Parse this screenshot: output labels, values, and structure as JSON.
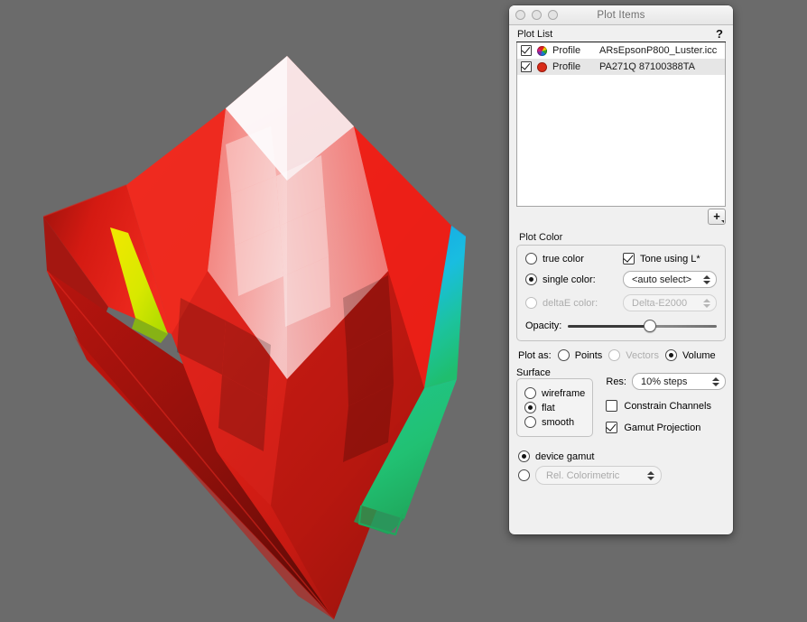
{
  "background_color": "#6b6b6b",
  "window": {
    "title": "Plot Items",
    "traffic_lights": [
      "close-button",
      "minimize-button",
      "zoom-button"
    ]
  },
  "plot_list": {
    "header_label": "Plot List",
    "help_label": "?",
    "add_button_label": "+",
    "rows": [
      {
        "checked": true,
        "swatch": "color-wheel-icon",
        "kind": "Profile",
        "name": "ARsEpsonP800_Luster.icc",
        "selected": false
      },
      {
        "checked": true,
        "swatch": "red-circle-icon",
        "kind": "Profile",
        "name": "PA271Q 87100388TA",
        "selected": true
      }
    ]
  },
  "plot_color": {
    "group_label": "Plot Color",
    "true_color_label": "true color",
    "single_color_label": "single color:",
    "deltae_color_label": "deltaE color:",
    "selected_mode": "single color",
    "single_color_value": "<auto select>",
    "deltae_color_value": "Delta-E2000",
    "tone_using_l_label": "Tone using L*",
    "tone_using_l_checked": true,
    "opacity_label": "Opacity:",
    "opacity_percent": 55
  },
  "plot_as": {
    "label": "Plot as:",
    "options": [
      {
        "label": "Points",
        "selected": false,
        "disabled": false
      },
      {
        "label": "Vectors",
        "selected": false,
        "disabled": true
      },
      {
        "label": "Volume",
        "selected": true,
        "disabled": false
      }
    ]
  },
  "surface": {
    "group_label": "Surface",
    "options": [
      {
        "label": "wireframe",
        "selected": false
      },
      {
        "label": "flat",
        "selected": true
      },
      {
        "label": "smooth",
        "selected": false
      }
    ]
  },
  "options_panel": {
    "res_label": "Res:",
    "res_value": "10% steps",
    "constrain_channels_label": "Constrain Channels",
    "constrain_channels_checked": false,
    "gamut_projection_label": "Gamut Projection",
    "gamut_projection_checked": true
  },
  "gamut_source": {
    "device_gamut_label": "device gamut",
    "device_gamut_selected": true,
    "intent_selected": false,
    "intent_value": "Rel. Colorimetric"
  },
  "plot_render": {
    "description": "3D faceted color gamut volume solid",
    "apex_color": "#f7eef0",
    "body_color": "#e81f1a",
    "dark_body_color": "#8e1410",
    "yellow_accent": "#ddf000",
    "cyan_accent": "#1fb8e8",
    "green_accent": "#1fbf72",
    "wireframe_color": "#1faf60"
  }
}
